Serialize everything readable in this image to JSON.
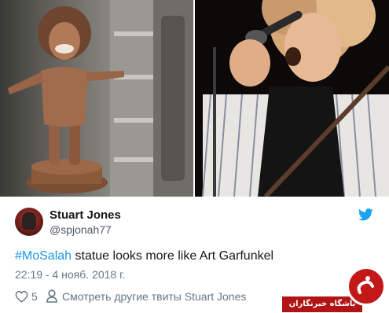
{
  "tweet": {
    "author_name": "Stuart Jones",
    "author_handle": "@spjonah77",
    "hashtag": "#MoSalah",
    "text": " statue looks more like Art Garfunkel",
    "timestamp": "22:19 - 4 нояб. 2018 г.",
    "likes": "5",
    "more_tweets_link": "Смотреть другие твиты Stuart Jones"
  },
  "watermark": {
    "text": "باشگاه خبرنگاران"
  },
  "colors": {
    "link": "#1b95e0",
    "text": "#14171a",
    "muted": "#657786",
    "twitter_blue": "#1da1f2",
    "badge_red": "#b11414"
  },
  "icons": [
    "twitter-bird-icon",
    "heart-icon",
    "person-icon"
  ]
}
